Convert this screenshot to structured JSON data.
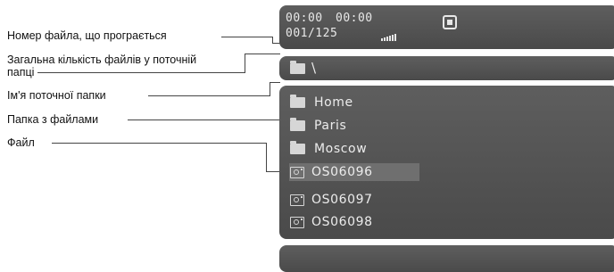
{
  "callouts": {
    "file_number": "Номер файла, що програється",
    "total_files_line1": "Загальна кількість файлів у поточній",
    "total_files_line2": "папці",
    "current_folder": "Ім'я поточної папки",
    "folder_with_files": "Папка з файлами",
    "file": "Файл"
  },
  "status": {
    "time_elapsed": "00:00",
    "time_total": "00:00",
    "file_counter": "001/125",
    "signal_icon": "signal-bars-icon",
    "stop_icon": "stop-icon"
  },
  "path": {
    "folder_icon": "folder-icon",
    "current": "\\"
  },
  "list": {
    "items": [
      {
        "type": "folder",
        "icon": "folder-icon",
        "label": "Home",
        "selected": false
      },
      {
        "type": "folder",
        "icon": "folder-icon",
        "label": "Paris",
        "selected": false
      },
      {
        "type": "folder",
        "icon": "folder-icon",
        "label": "Moscow",
        "selected": false
      },
      {
        "type": "file",
        "icon": "photo-file-icon",
        "label": "OS06096",
        "selected": true
      },
      {
        "type": "file",
        "icon": "photo-file-icon",
        "label": "OS06097",
        "selected": false
      },
      {
        "type": "file",
        "icon": "photo-file-icon",
        "label": "OS06098",
        "selected": false
      }
    ]
  }
}
